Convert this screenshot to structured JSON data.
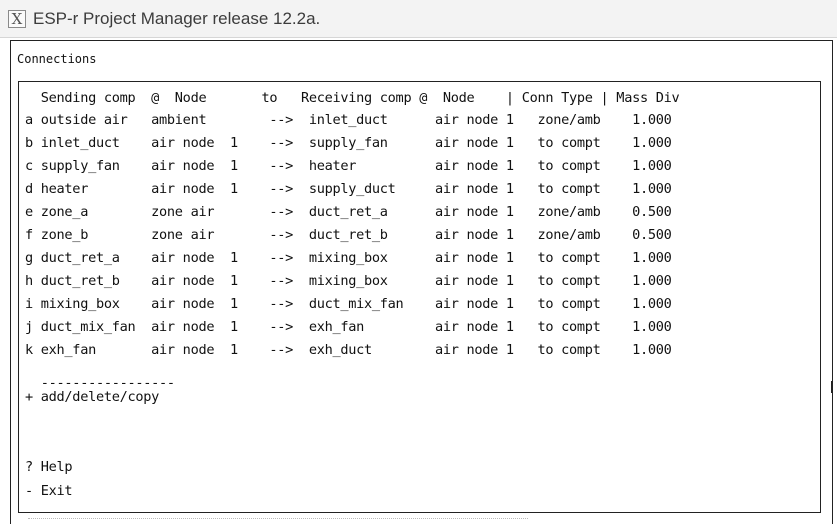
{
  "window": {
    "title": "ESP-r Project Manager release 12.2a.",
    "close_glyph": "X"
  },
  "menu": {
    "title": "Connections"
  },
  "list": {
    "header": "  Sending comp  @  Node       to   Receiving comp @  Node    | Conn Type | Mass Div",
    "rows": [
      "a outside air   ambient        -->  inlet_duct      air node 1   zone/amb    1.000",
      "b inlet_duct    air node  1    -->  supply_fan      air node 1   to compt    1.000",
      "c supply_fan    air node  1    -->  heater          air node 1   to compt    1.000",
      "d heater        air node  1    -->  supply_duct     air node 1   to compt    1.000",
      "e zone_a        zone air       -->  duct_ret_a      air node 1   zone/amb    0.500",
      "f zone_b        zone air       -->  duct_ret_b      air node 1   zone/amb    0.500",
      "g duct_ret_a    air node  1    -->  mixing_box      air node 1   to compt    1.000",
      "h duct_ret_b    air node  1    -->  mixing_box      air node 1   to compt    1.000",
      "i mixing_box    air node  1    -->  duct_mix_fan    air node 1   to compt    1.000",
      "j duct_mix_fan  air node  1    -->  exh_fan         air node 1   to compt    1.000",
      "k exh_fan       air node  1    -->  exh_duct        air node 1   to compt    1.000"
    ],
    "separator": "  -----------------",
    "add_option": "+ add/delete/copy",
    "help_option": "? Help",
    "exit_option": "- Exit"
  }
}
